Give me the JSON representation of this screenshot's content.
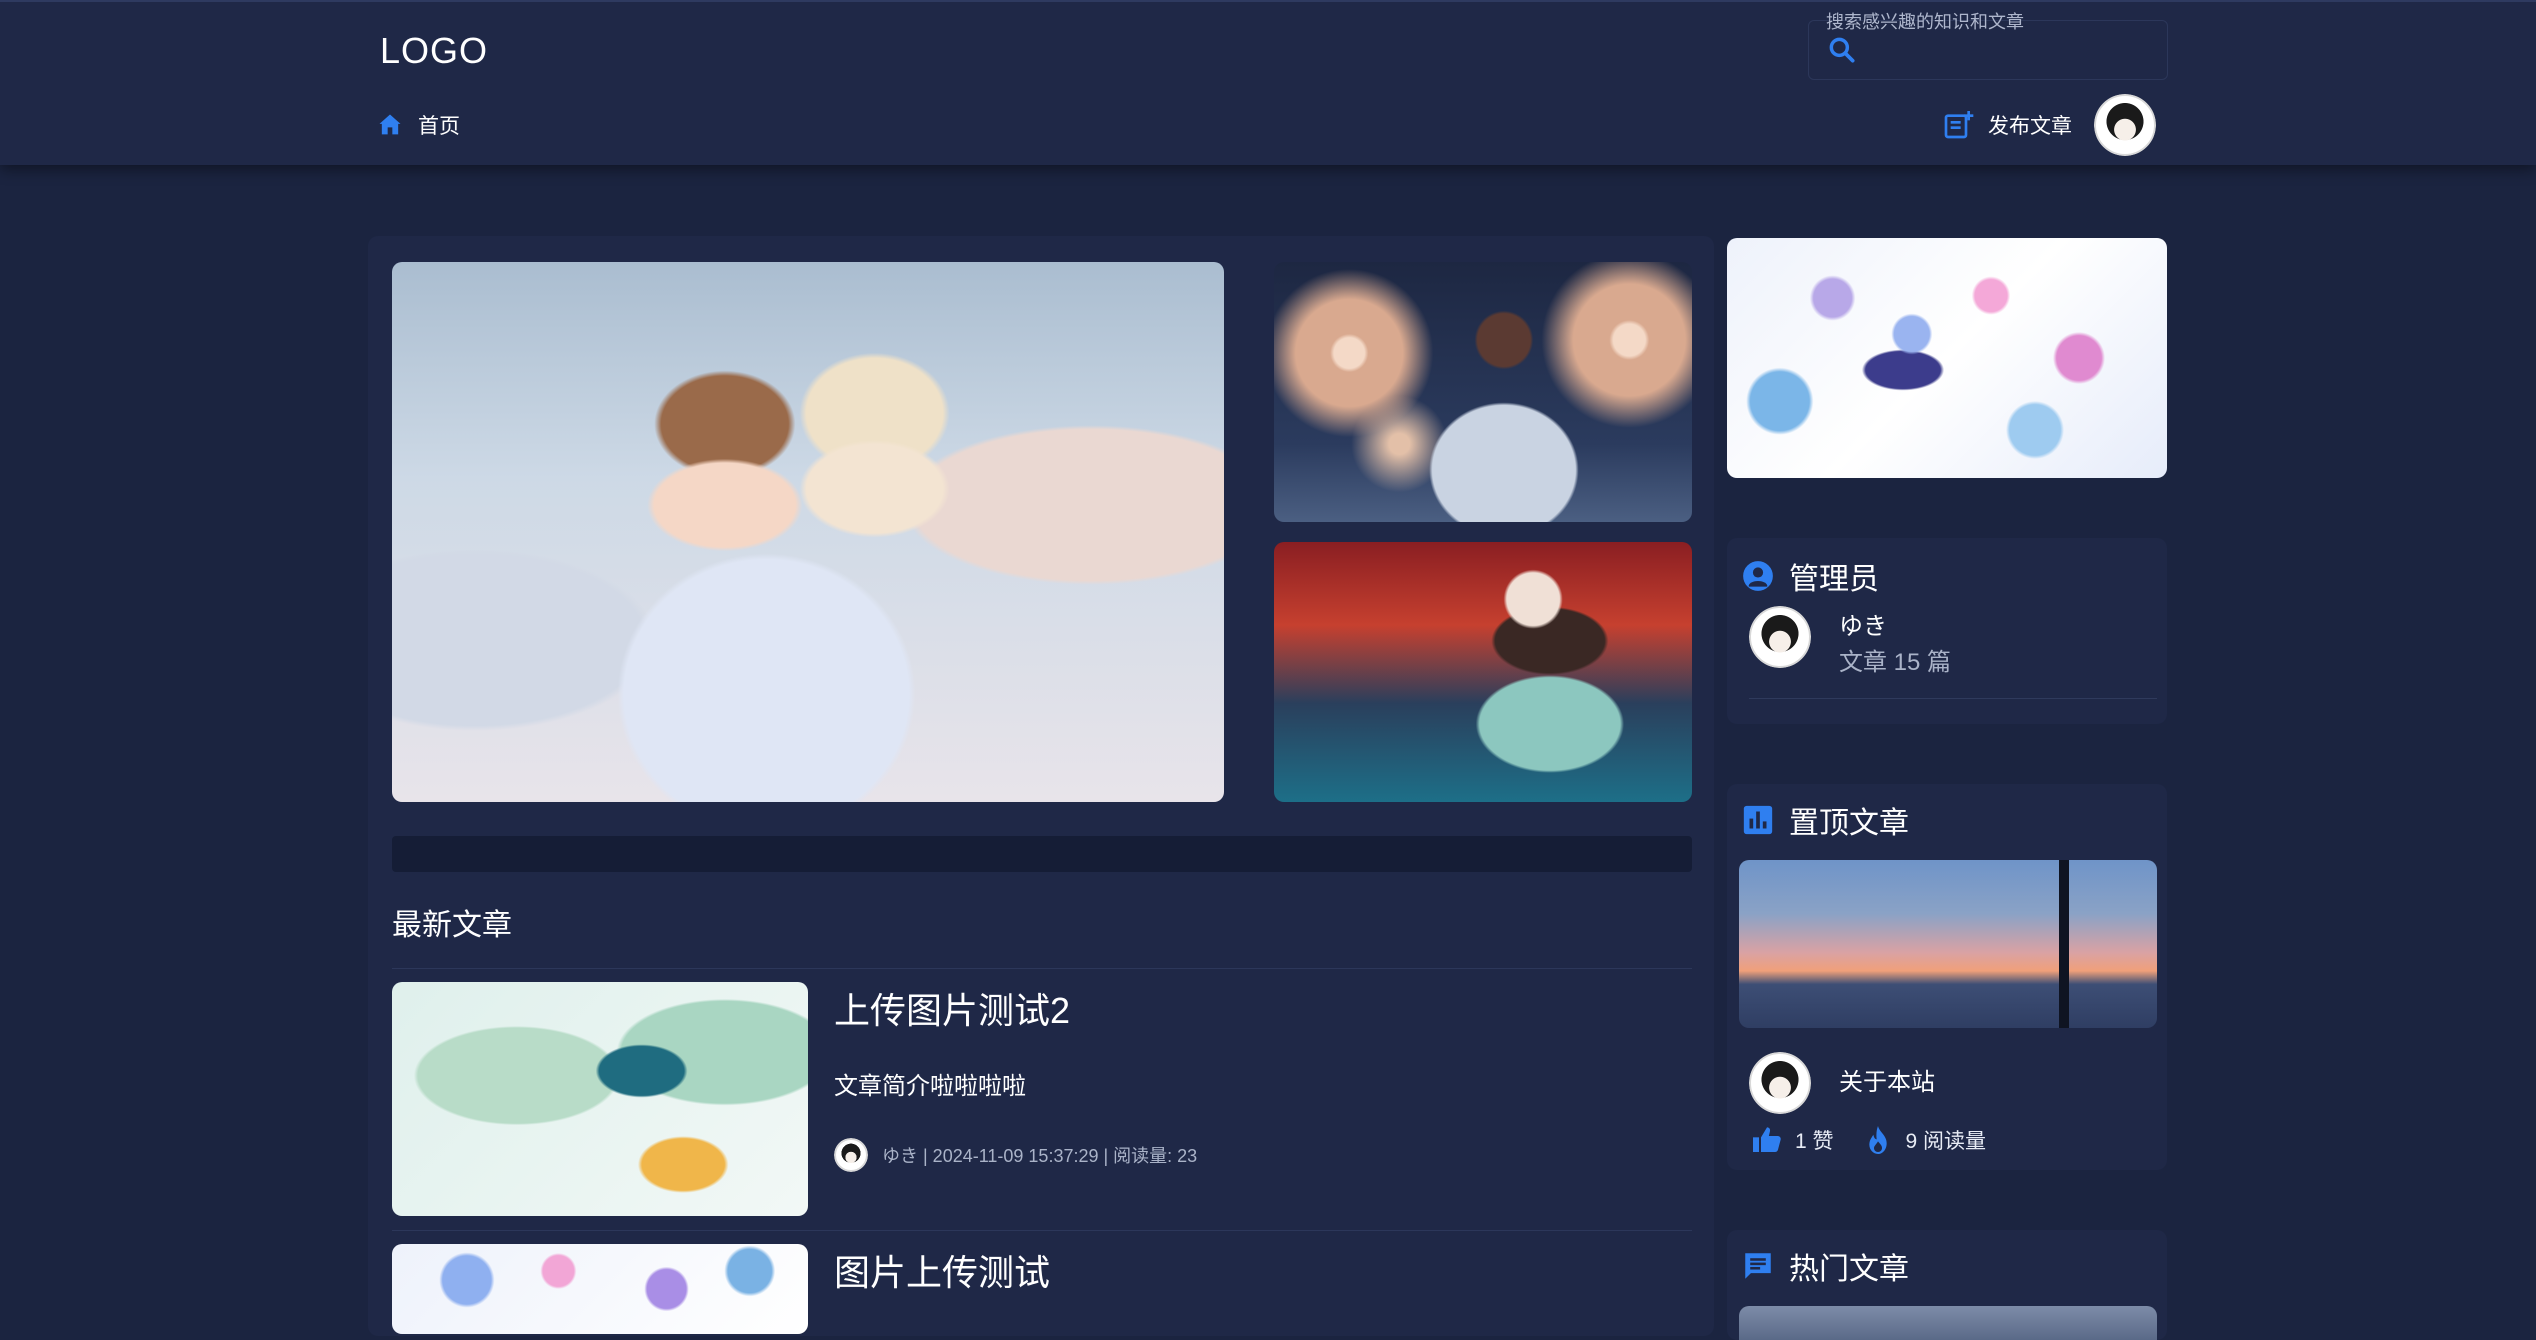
{
  "header": {
    "logo": "LOGO",
    "search_placeholder": "搜索感兴趣的知识和文章",
    "nav_home": "首页",
    "publish": "发布文章"
  },
  "main": {
    "latest_title": "最新文章",
    "articles": [
      {
        "title": "上传图片测试2",
        "desc": "文章简介啦啦啦啦",
        "meta": "ゆき  |  2024-11-09 15:37:29  |  阅读量: 23"
      },
      {
        "title": "图片上传测试"
      }
    ]
  },
  "sidebar": {
    "admin": {
      "heading": "管理员",
      "name": "ゆき",
      "article_count": "文章 15 篇"
    },
    "top_articles": {
      "heading": "置顶文章",
      "item_title": "关于本站",
      "likes": "1 赞",
      "reads": "9 阅读量"
    },
    "hot_articles": {
      "heading": "热门文章"
    }
  },
  "colors": {
    "accent": "#2f7ff0",
    "background": "#1b2440",
    "panel": "#1f2847"
  },
  "icons": [
    "search-icon",
    "home-icon",
    "publish-icon",
    "admin-icon",
    "chart-icon",
    "like-icon",
    "fire-icon",
    "chat-icon"
  ]
}
